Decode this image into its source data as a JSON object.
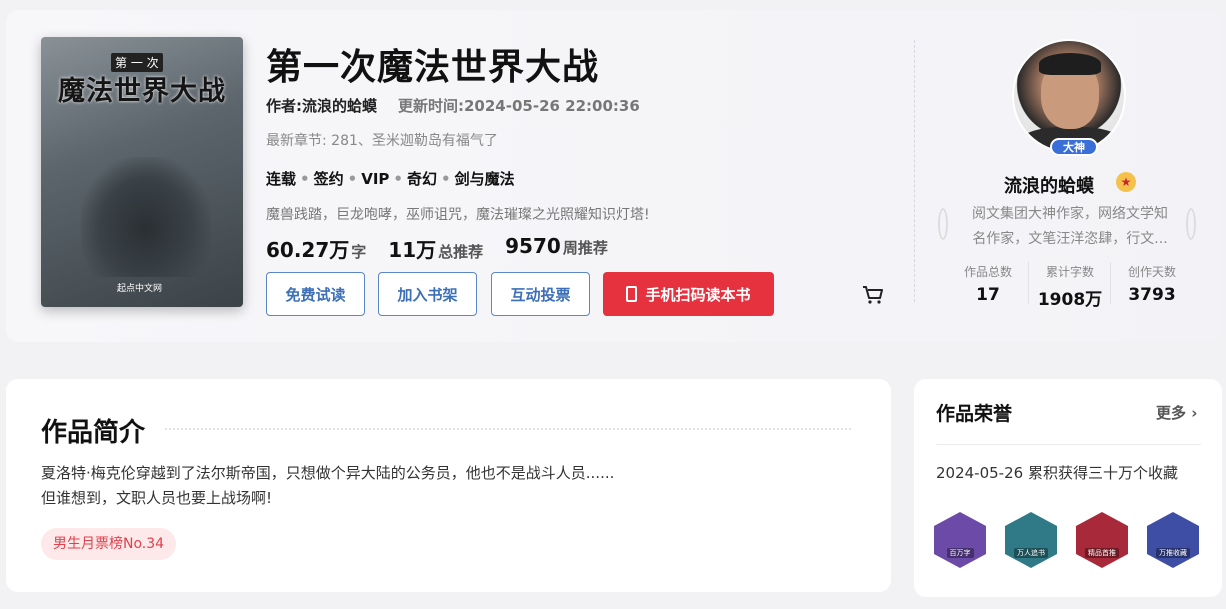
{
  "book": {
    "cover_title": "魔法世界大战",
    "cover_subtitle": "第 一 次",
    "cover_logo": "起点中文网",
    "title": "第一次魔法世界大战",
    "author": "作者:流浪的蛤蟆",
    "update": "更新时间:2024-05-26 22:00:36",
    "latest_chapter": "最新章节: 281、圣米迦勒岛有福气了",
    "tags": [
      "连载",
      "签约",
      "VIP",
      "奇幻",
      "剑与魔法"
    ],
    "short_intro": "魔兽践踏，巨龙咆哮，巫师诅咒，魔法璀璨之光照耀知识灯塔!",
    "stats": [
      {
        "value": "60.27万",
        "unit": "字"
      },
      {
        "value": "11万",
        "unit": "总推荐"
      },
      {
        "value": "9570",
        "unit": "周推荐"
      }
    ]
  },
  "actions": {
    "trial": "免费试读",
    "shelf": "加入书架",
    "vote": "互动投票",
    "scan": "手机扫码读本书"
  },
  "author_card": {
    "badge": "大神",
    "name": "流浪的蛤蟆",
    "desc_line1": "阅文集团大神作家，网络文学知",
    "desc_line2": "名作家，文笔汪洋恣肆，行文...",
    "stats": [
      {
        "label": "作品总数",
        "value": "17"
      },
      {
        "label": "累计字数",
        "value": "1908万"
      },
      {
        "label": "创作天数",
        "value": "3793"
      }
    ]
  },
  "synopsis": {
    "heading": "作品简介",
    "line1": "夏洛特·梅克伦穿越到了法尔斯帝国，只想做个异大陆的公务员，他也不是战斗人员......",
    "line2": "但谁想到，文职人员也要上战场啊!",
    "rank": "男生月票榜No.34"
  },
  "honors": {
    "heading": "作品荣誉",
    "more": "更多",
    "item": "2024-05-26 累积获得三十万个收藏",
    "badges": [
      {
        "label": "百万字",
        "color": "#6b4aa8"
      },
      {
        "label": "万人追书",
        "color": "#2f7a86"
      },
      {
        "label": "精品首推",
        "color": "#a8293a"
      },
      {
        "label": "万推收藏",
        "color": "#3e4ea4"
      }
    ]
  }
}
